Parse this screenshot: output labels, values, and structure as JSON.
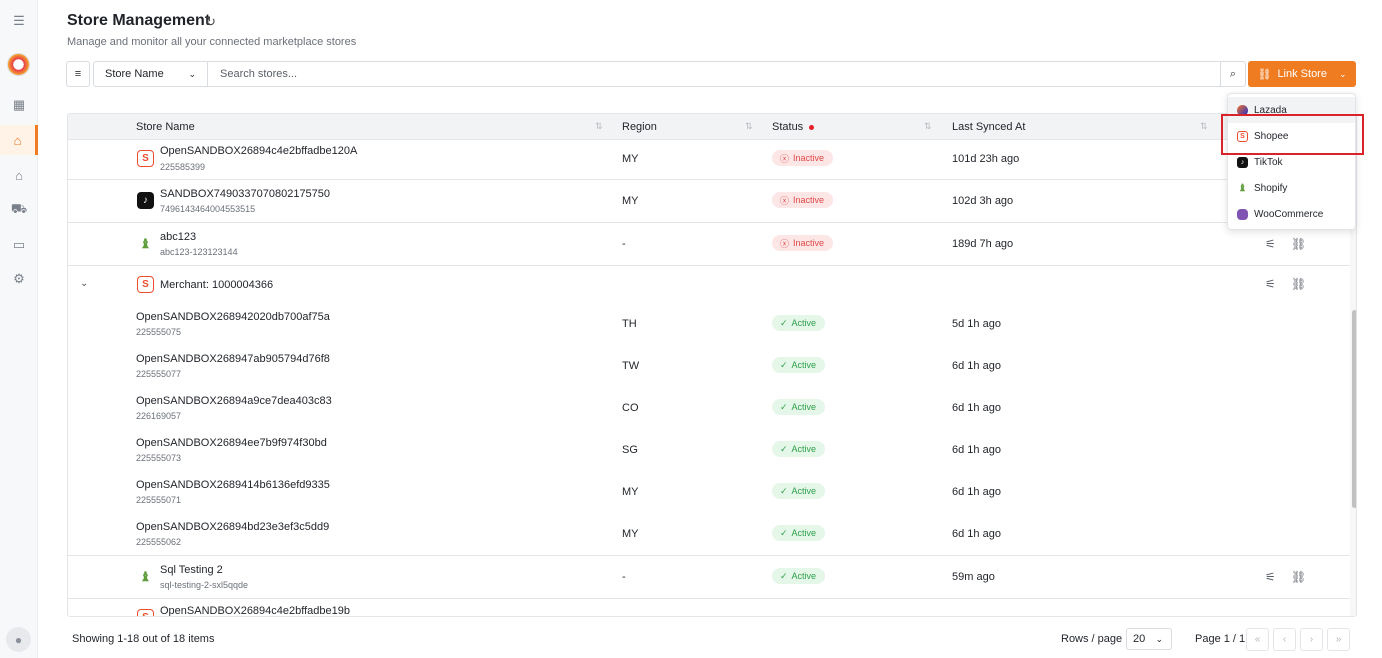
{
  "sidebar": {
    "menu_icon": "menu-icon",
    "items": [
      "dashboard-icon",
      "store-icon",
      "warehouse-icon",
      "truck-icon",
      "wallet-icon",
      "settings-icon"
    ],
    "active": "store-icon"
  },
  "header": {
    "title": "Store Management",
    "subtitle": "Manage and monitor all your connected marketplace stores"
  },
  "toolbar": {
    "field_select": "Store Name",
    "search_placeholder": "Search stores...",
    "link_store_label": "Link Store"
  },
  "table": {
    "columns": [
      "Store Name",
      "Region",
      "Status",
      "Last Synced At"
    ],
    "rows": [
      {
        "name": "OpenSANDBOX26894c4e2bffadbe120A",
        "id": "225585399",
        "platform": "Shopee",
        "region": "MY",
        "status": "Inactive",
        "synced": "101d 23h ago"
      },
      {
        "name": "SANDBOX7490337070802175750",
        "id": "7496143464004553515",
        "platform": "TikTok",
        "region": "MY",
        "status": "Inactive",
        "synced": "102d 3h ago"
      },
      {
        "name": "abc123",
        "id": "abc123-123123144",
        "platform": "Shopify",
        "region": "-",
        "status": "Inactive",
        "synced": "189d 7h ago"
      }
    ],
    "merchant_group": {
      "label": "Merchant: 1000004366",
      "platform": "Shopee",
      "children": [
        {
          "name": "OpenSANDBOX268942020db700af75a",
          "id": "225555075",
          "region": "TH",
          "status": "Active",
          "synced": "5d 1h ago"
        },
        {
          "name": "OpenSANDBOX268947ab905794d76f8",
          "id": "225555077",
          "region": "TW",
          "status": "Active",
          "synced": "6d 1h ago"
        },
        {
          "name": "OpenSANDBOX26894a9ce7dea403c83",
          "id": "226169057",
          "region": "CO",
          "status": "Active",
          "synced": "6d 1h ago"
        },
        {
          "name": "OpenSANDBOX26894ee7b9f974f30bd",
          "id": "225555073",
          "region": "SG",
          "status": "Active",
          "synced": "6d 1h ago"
        },
        {
          "name": "OpenSANDBOX2689414b6136efd9335",
          "id": "225555071",
          "region": "MY",
          "status": "Active",
          "synced": "6d 1h ago"
        },
        {
          "name": "OpenSANDBOX26894bd23e3ef3c5dd9",
          "id": "225555062",
          "region": "MY",
          "status": "Active",
          "synced": "6d 1h ago"
        }
      ]
    },
    "rows_after": [
      {
        "name": "Sql Testing 2",
        "id": "sql-testing-2-sxl5qqde",
        "platform": "Shopify",
        "region": "-",
        "status": "Active",
        "synced": "59m ago"
      },
      {
        "name": "OpenSANDBOX26894c4e2bffadbe19b",
        "platform": "Shopee"
      }
    ]
  },
  "footer": {
    "showing": "Showing 1-18 out of 18 items",
    "rows_per_page_label": "Rows / page",
    "rows_per_page": "20",
    "page": "Page 1 / 1"
  },
  "dropdown": {
    "items": [
      "Lazada",
      "Shopee",
      "TikTok",
      "Shopify",
      "WooCommerce"
    ],
    "highlighted": "Shopee"
  },
  "colors": {
    "accent": "#f07c22",
    "inactive": "#e04848",
    "active": "#2ea04a",
    "highlight_box": "#d8232a"
  }
}
